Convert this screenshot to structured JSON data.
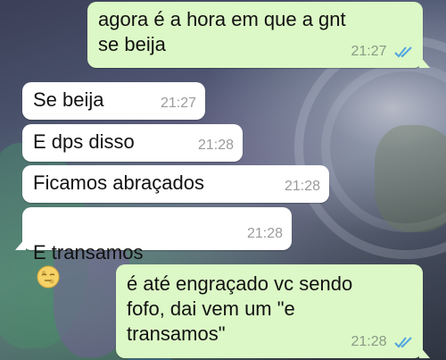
{
  "colors": {
    "incoming_bubble": "#ffffff",
    "outgoing_bubble": "#dcf8c6",
    "read_ticks": "#4fa3e0",
    "timestamp": "#9b9b9b"
  },
  "messages": [
    {
      "direction": "out",
      "text": "agora é a hora em que a gnt\nse beija",
      "time": "21:27",
      "status": "read"
    },
    {
      "direction": "in",
      "text": "Se beija",
      "time": "21:27"
    },
    {
      "direction": "in",
      "text": "E dps disso",
      "time": "21:28"
    },
    {
      "direction": "in",
      "text": "Ficamos abraçados",
      "time": "21:28"
    },
    {
      "direction": "in",
      "text": "E transamos",
      "emoji": "moon-face-emoji",
      "time": "21:28"
    },
    {
      "direction": "out",
      "text": "é até engraçado vc sendo\nfofo, dai vem um \"e\ntransamos\"",
      "time": "21:28",
      "status": "read"
    }
  ]
}
